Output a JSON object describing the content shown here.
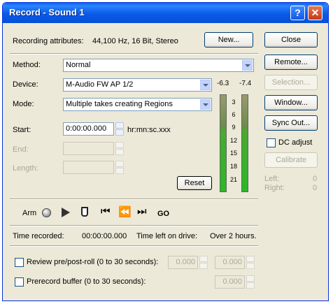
{
  "window": {
    "title": "Record - Sound 1"
  },
  "attributes": {
    "label": "Recording attributes:",
    "value": "44,100 Hz, 16 Bit, Stereo"
  },
  "buttons": {
    "new": "New...",
    "close": "Close",
    "remote": "Remote...",
    "selection": "Selection...",
    "window": "Window...",
    "sync_out": "Sync Out...",
    "calibrate": "Calibrate",
    "reset": "Reset"
  },
  "method": {
    "label": "Method:",
    "value": "Normal"
  },
  "device": {
    "label": "Device:",
    "value": "M-Audio FW AP 1/2"
  },
  "mode": {
    "label": "Mode:",
    "value": "Multiple takes creating Regions"
  },
  "start": {
    "label": "Start:",
    "value": "0:00:00.000",
    "format": "hr:mn:sc.xxx"
  },
  "end": {
    "label": "End:"
  },
  "length": {
    "label": "Length:"
  },
  "meters": {
    "left_peak": "-6.3",
    "right_peak": "-7.4",
    "scale": [
      "3",
      "6",
      "9",
      "12",
      "15",
      "18",
      "21"
    ]
  },
  "dc_adjust": {
    "label": "DC adjust",
    "checked": false
  },
  "levels": {
    "left_label": "Left:",
    "left_value": "0",
    "right_label": "Right:",
    "right_value": "0"
  },
  "transport": {
    "arm_label": "Arm",
    "go_label": "GO"
  },
  "status": {
    "recorded_label": "Time recorded:",
    "recorded_value": "00:00:00.000",
    "left_label": "Time left on drive:",
    "left_value": "Over 2 hours."
  },
  "review": {
    "label": "Review pre/post-roll (0 to 30 seconds):",
    "pre": "0.000",
    "post": "0.000",
    "checked": false
  },
  "prerecord": {
    "label": "Prerecord buffer (0 to 30 seconds):",
    "value": "0.000",
    "checked": false
  }
}
